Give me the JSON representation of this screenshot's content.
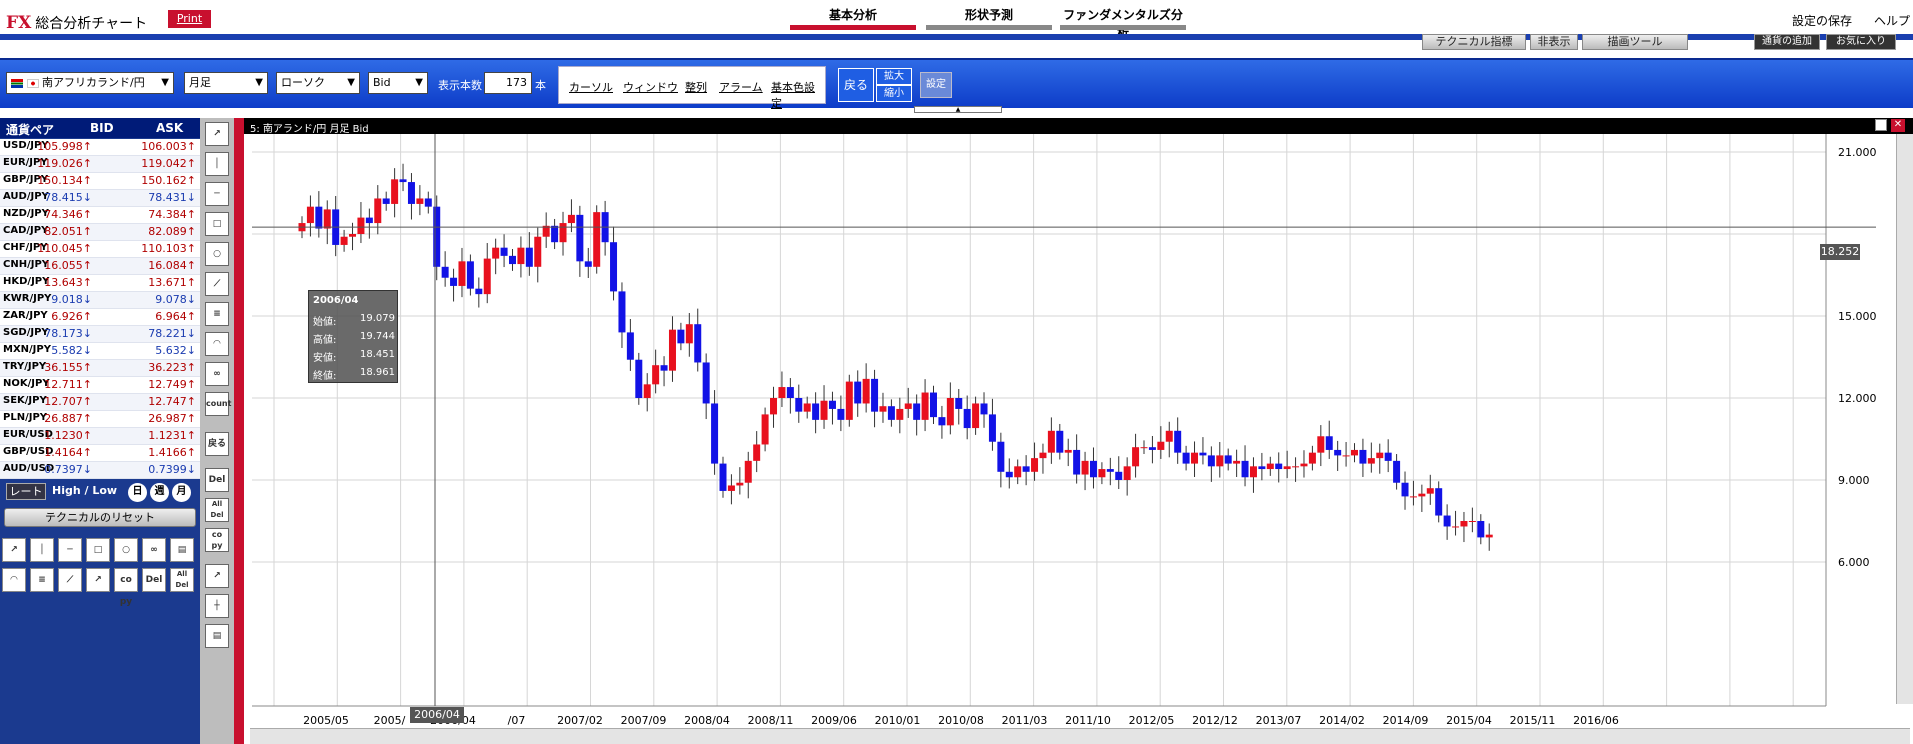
{
  "header": {
    "logo_fx": "FX",
    "logo_text": "総合分析チャート",
    "print_label": "Print",
    "tabs": [
      "基本分析",
      "形状予測",
      "ファンダメンタルズ分析"
    ],
    "save_settings": "設定の保存",
    "help": "ヘルプ"
  },
  "subbar": {
    "technical": "テクニカル指標",
    "hide": "非表示",
    "draw_tools": "描画ツール",
    "add_currency": "通貨の追加",
    "favorites": "お気に入り"
  },
  "toolbar": {
    "pair_select": "南アフリカランド/円",
    "period_select": "月足",
    "chart_type_select": "ローソク",
    "price_type_select": "Bid",
    "count_label": "表示本数",
    "count_value": "173",
    "count_unit": "本",
    "menu": [
      "カーソル",
      "ウィンドウ",
      "整列",
      "アラーム",
      "基本色設定"
    ],
    "back": "戻る",
    "zoom_in": "拡大",
    "zoom_out": "縮小",
    "settings": "設定"
  },
  "rates": {
    "header_pair": "通貨ペア",
    "header_bid": "BID",
    "header_ask": "ASK",
    "rows": [
      {
        "pair": "USD/JPY",
        "bid": "105.998↑",
        "ask": "106.003↑",
        "dir": "up"
      },
      {
        "pair": "EUR/JPY",
        "bid": "119.026↑",
        "ask": "119.042↑",
        "dir": "up"
      },
      {
        "pair": "GBP/JPY",
        "bid": "150.134↑",
        "ask": "150.162↑",
        "dir": "up"
      },
      {
        "pair": "AUD/JPY",
        "bid": "78.415↓",
        "ask": "78.431↓",
        "dir": "down"
      },
      {
        "pair": "NZD/JPY",
        "bid": "74.346↑",
        "ask": "74.384↑",
        "dir": "up"
      },
      {
        "pair": "CAD/JPY",
        "bid": "82.051↑",
        "ask": "82.089↑",
        "dir": "up"
      },
      {
        "pair": "CHF/JPY",
        "bid": "110.045↑",
        "ask": "110.103↑",
        "dir": "up"
      },
      {
        "pair": "CNH/JPY",
        "bid": "16.055↑",
        "ask": "16.084↑",
        "dir": "up"
      },
      {
        "pair": "HKD/JPY",
        "bid": "13.643↑",
        "ask": "13.671↑",
        "dir": "up"
      },
      {
        "pair": "KWR/JPY",
        "bid": "9.018↓",
        "ask": "9.078↓",
        "dir": "down"
      },
      {
        "pair": "ZAR/JPY",
        "bid": "6.926↑",
        "ask": "6.964↑",
        "dir": "up"
      },
      {
        "pair": "SGD/JPY",
        "bid": "78.173↓",
        "ask": "78.221↓",
        "dir": "down"
      },
      {
        "pair": "MXN/JPY",
        "bid": "5.582↓",
        "ask": "5.632↓",
        "dir": "down"
      },
      {
        "pair": "TRY/JPY",
        "bid": "36.155↑",
        "ask": "36.223↑",
        "dir": "up"
      },
      {
        "pair": "NOK/JPY",
        "bid": "12.711↑",
        "ask": "12.749↑",
        "dir": "up"
      },
      {
        "pair": "SEK/JPY",
        "bid": "12.707↑",
        "ask": "12.747↑",
        "dir": "up"
      },
      {
        "pair": "PLN/JPY",
        "bid": "26.887↑",
        "ask": "26.987↑",
        "dir": "up"
      },
      {
        "pair": "EUR/USD",
        "bid": "1.1230↑",
        "ask": "1.1231↑",
        "dir": "up"
      },
      {
        "pair": "GBP/USD",
        "bid": "1.4164↑",
        "ask": "1.4166↑",
        "dir": "up"
      },
      {
        "pair": "AUD/USD",
        "bid": "0.7397↓",
        "ask": "0.7399↓",
        "dir": "down"
      }
    ],
    "tab_rate": "レート",
    "tab_hilo": "High / Low",
    "btn_day": "日",
    "btn_week": "週",
    "btn_month": "月",
    "reset": "テクニカルのリセット"
  },
  "tools": {
    "count": "count",
    "back": "戻る",
    "del": "Del",
    "alldel": "All Del",
    "copy": "co py"
  },
  "chart": {
    "title": "5: 南アランド/円 月足 Bid",
    "crosshair_date": "2006/04",
    "crosshair_price": "18.252",
    "tooltip": {
      "date": "2006/04",
      "open_label": "始値:",
      "open": "19.079",
      "high_label": "高値:",
      "high": "19.744",
      "low_label": "安値:",
      "low": "18.451",
      "close_label": "終値:",
      "close": "18.961"
    },
    "colors": {
      "up": "#e8101e",
      "down": "#1212e6"
    }
  },
  "chart_data": {
    "type": "candlestick",
    "title": "南アランド/円 月足 Bid",
    "x_ticks": [
      "2005/05",
      "2005/",
      "2006/04",
      "/07",
      "2007/02",
      "2007/09",
      "2008/04",
      "2008/11",
      "2009/06",
      "2010/01",
      "2010/08",
      "2011/03",
      "2011/10",
      "2012/05",
      "2012/12",
      "2013/07",
      "2014/02",
      "2014/09",
      "2015/04",
      "2015/11",
      "2016/06"
    ],
    "y_ticks": [
      "21.000",
      "15.000",
      "12.000",
      "9.000",
      "6.000"
    ],
    "ylim": [
      6,
      21
    ],
    "candles_close": [
      18.4,
      19.0,
      18.2,
      18.9,
      17.6,
      17.9,
      18.0,
      18.6,
      18.4,
      19.3,
      19.1,
      20.0,
      19.9,
      19.1,
      19.3,
      19.0,
      16.8,
      16.4,
      16.1,
      17.0,
      16.0,
      15.8,
      17.1,
      17.5,
      17.2,
      16.9,
      17.5,
      16.8,
      17.9,
      18.3,
      17.7,
      18.4,
      18.7,
      17.0,
      16.8,
      18.8,
      17.7,
      15.9,
      14.4,
      13.4,
      12.0,
      12.5,
      13.2,
      13.0,
      14.5,
      14.0,
      14.7,
      13.3,
      11.8,
      9.6,
      8.6,
      8.8,
      8.9,
      9.7,
      10.3,
      11.4,
      12.0,
      12.4,
      12.0,
      11.5,
      11.8,
      11.2,
      11.9,
      11.6,
      11.2,
      12.6,
      11.8,
      12.7,
      11.5,
      11.7,
      11.2,
      11.6,
      11.8,
      11.2,
      12.2,
      11.3,
      11.0,
      12.0,
      11.6,
      10.9,
      11.8,
      11.4,
      10.4,
      9.3,
      9.1,
      9.5,
      9.3,
      9.8,
      10.0,
      10.8,
      10.0,
      10.1,
      9.2,
      9.7,
      9.1,
      9.4,
      9.3,
      9.0,
      9.5,
      10.2,
      10.2,
      10.1,
      10.4,
      10.8,
      10.0,
      9.6,
      10.0,
      9.9,
      9.5,
      9.9,
      9.6,
      9.7,
      9.1,
      9.5,
      9.4,
      9.6,
      9.4,
      9.5,
      9.5,
      9.6,
      10.0,
      10.6,
      10.1,
      9.9,
      9.9,
      10.1,
      9.6,
      9.8,
      10.0,
      9.7,
      8.9,
      8.4,
      8.4,
      8.5,
      8.7,
      7.7,
      7.3,
      7.3,
      7.5,
      7.5,
      6.9,
      7.0
    ]
  }
}
